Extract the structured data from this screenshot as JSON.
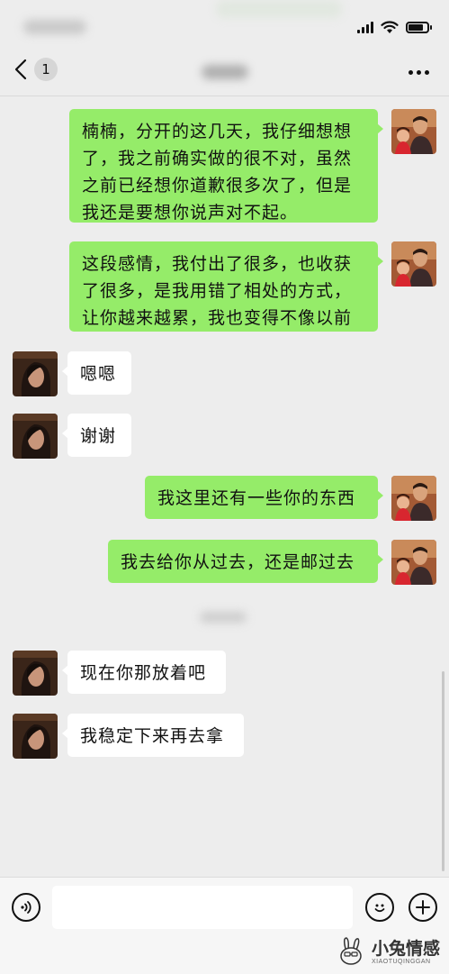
{
  "nav": {
    "unread_count": "1"
  },
  "messages": [
    {
      "side": "right",
      "avatar": "avatar-man-icon",
      "lines": [
        "楠楠，分开的这几天，我仔细想想",
        "了，我之前确实做的很不对，虽然",
        "之前已经想你道歉很多次了，但是",
        "我还是要想你说声对不起。"
      ]
    },
    {
      "side": "right",
      "avatar": "avatar-man-icon",
      "lines": [
        "这段感情，我付出了很多，也收获",
        "了很多，是我用错了相处的方式，",
        "让你越来越累，我也变得不像以前"
      ]
    },
    {
      "side": "left",
      "avatar": "avatar-woman-icon",
      "lines": [
        "嗯嗯"
      ]
    },
    {
      "side": "left",
      "avatar": "avatar-woman-icon",
      "lines": [
        "谢谢"
      ]
    },
    {
      "side": "right",
      "avatar": "avatar-man-icon",
      "lines": [
        "我这里还有一些你的东西"
      ]
    },
    {
      "side": "right",
      "avatar": "avatar-man-icon",
      "lines": [
        "我去给你从过去，还是邮过去"
      ]
    },
    {
      "side": "left",
      "avatar": "avatar-woman-icon",
      "lines": [
        "现在你那放着吧"
      ]
    },
    {
      "side": "left",
      "avatar": "avatar-woman-icon",
      "lines": [
        "我稳定下来再去拿"
      ]
    }
  ],
  "input_bar": {
    "placeholder": ""
  },
  "watermark": {
    "title": "小兔情感",
    "subtitle": "XIAOTUQINGGAN"
  },
  "colors": {
    "sent_bubble": "#95ec69",
    "received_bubble": "#ffffff",
    "background": "#ededed"
  }
}
